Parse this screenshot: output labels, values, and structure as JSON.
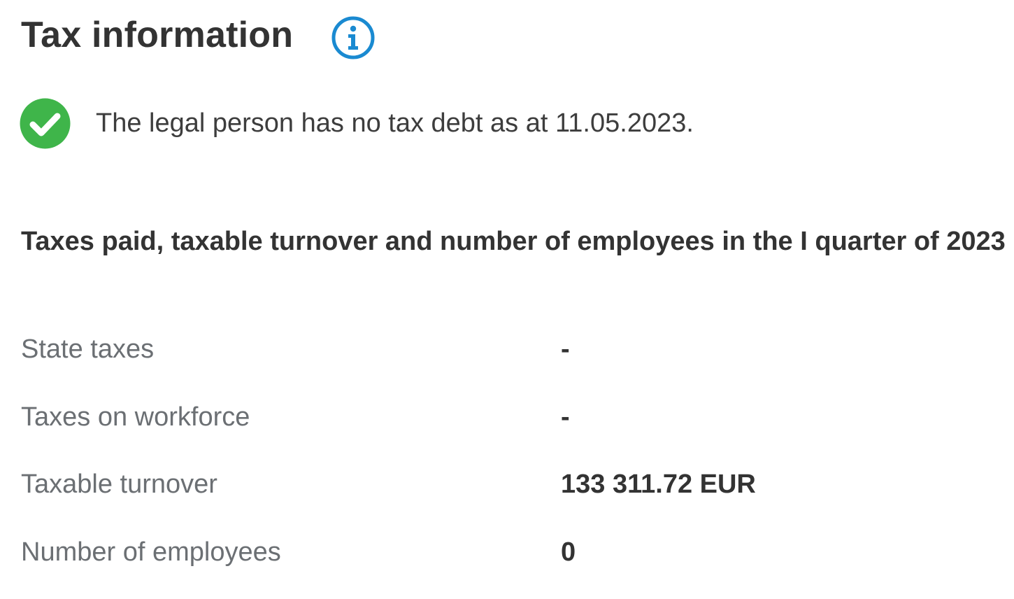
{
  "header": {
    "title": "Tax information",
    "info_icon": "info-circle-icon",
    "info_icon_color": "#1a8ad1"
  },
  "status": {
    "icon": "check-circle-icon",
    "icon_color": "#3fb54a",
    "text": "The legal person has no tax debt as at 11.05.2023."
  },
  "section": {
    "title": "Taxes paid, taxable turnover and number of employees in the I quarter of 2023"
  },
  "rows": [
    {
      "label": "State taxes",
      "value": "-"
    },
    {
      "label": "Taxes on workforce",
      "value": "-"
    },
    {
      "label": "Taxable turnover",
      "value": "133 311.72 EUR"
    },
    {
      "label": "Number of employees",
      "value": "0"
    }
  ]
}
